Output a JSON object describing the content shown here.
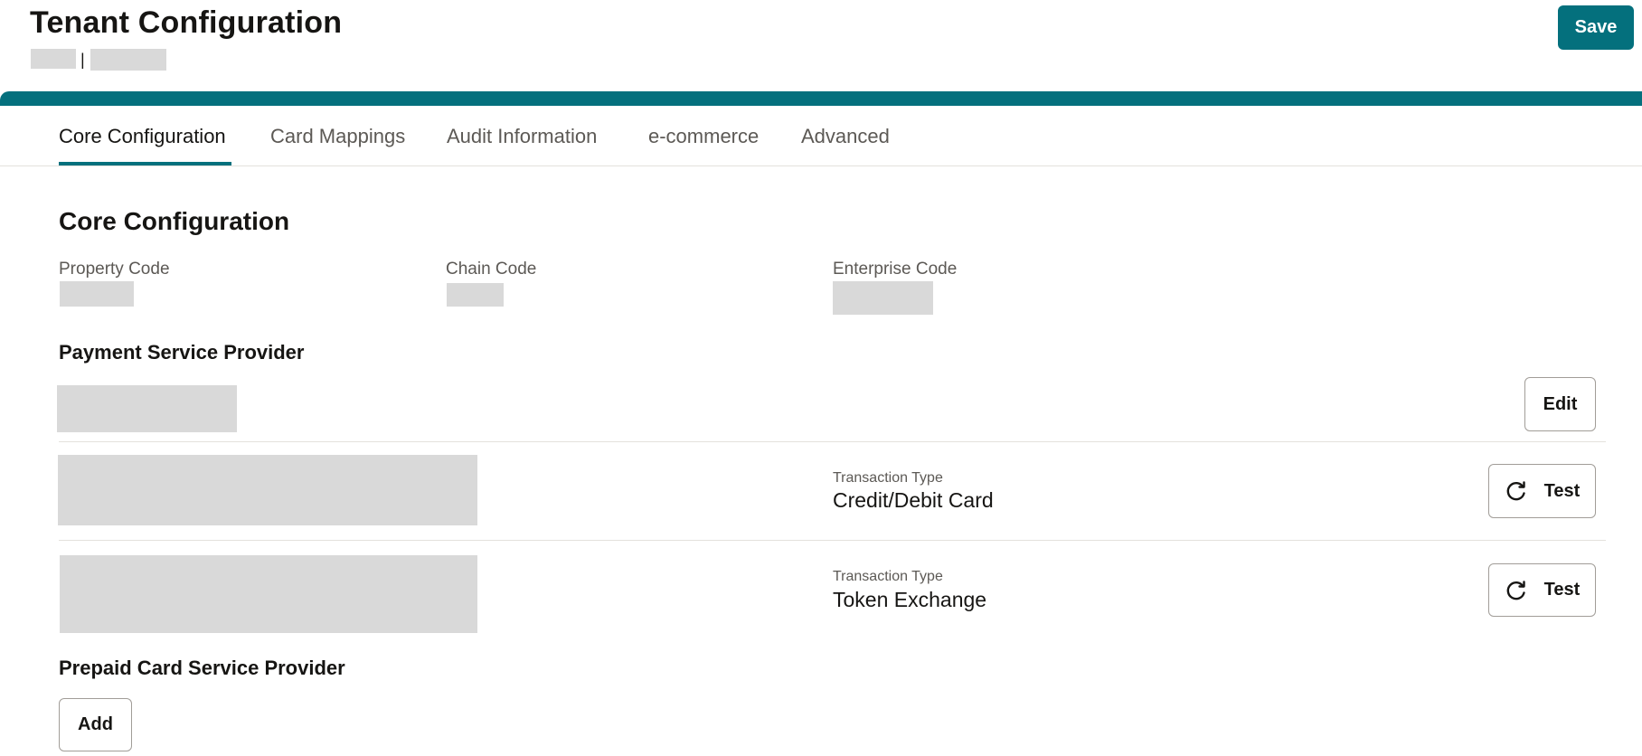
{
  "header": {
    "title": "Tenant Configuration",
    "subtitle_separator": "|",
    "save_label": "Save"
  },
  "tabs": [
    {
      "label": "Core Configuration",
      "active": true
    },
    {
      "label": "Card Mappings",
      "active": false
    },
    {
      "label": "Audit Information",
      "active": false
    },
    {
      "label": "e-commerce",
      "active": false
    },
    {
      "label": "Advanced",
      "active": false
    }
  ],
  "core": {
    "section_title": "Core Configuration",
    "fields": [
      {
        "label": "Property Code"
      },
      {
        "label": "Chain Code"
      },
      {
        "label": "Enterprise Code"
      }
    ]
  },
  "payment": {
    "heading": "Payment Service Provider",
    "edit_label": "Edit",
    "transactions": [
      {
        "type_label": "Transaction Type",
        "type_value": "Credit/Debit Card",
        "test_label": "Test",
        "icon": "refresh-icon"
      },
      {
        "type_label": "Transaction Type",
        "type_value": "Token Exchange",
        "test_label": "Test",
        "icon": "refresh-icon"
      }
    ]
  },
  "prepaid": {
    "heading": "Prepaid Card Service Provider",
    "add_label": "Add"
  },
  "colors": {
    "accent": "#04707d",
    "redaction": "#d9d9d9",
    "text": "#161513",
    "muted_text": "#5c5955"
  }
}
